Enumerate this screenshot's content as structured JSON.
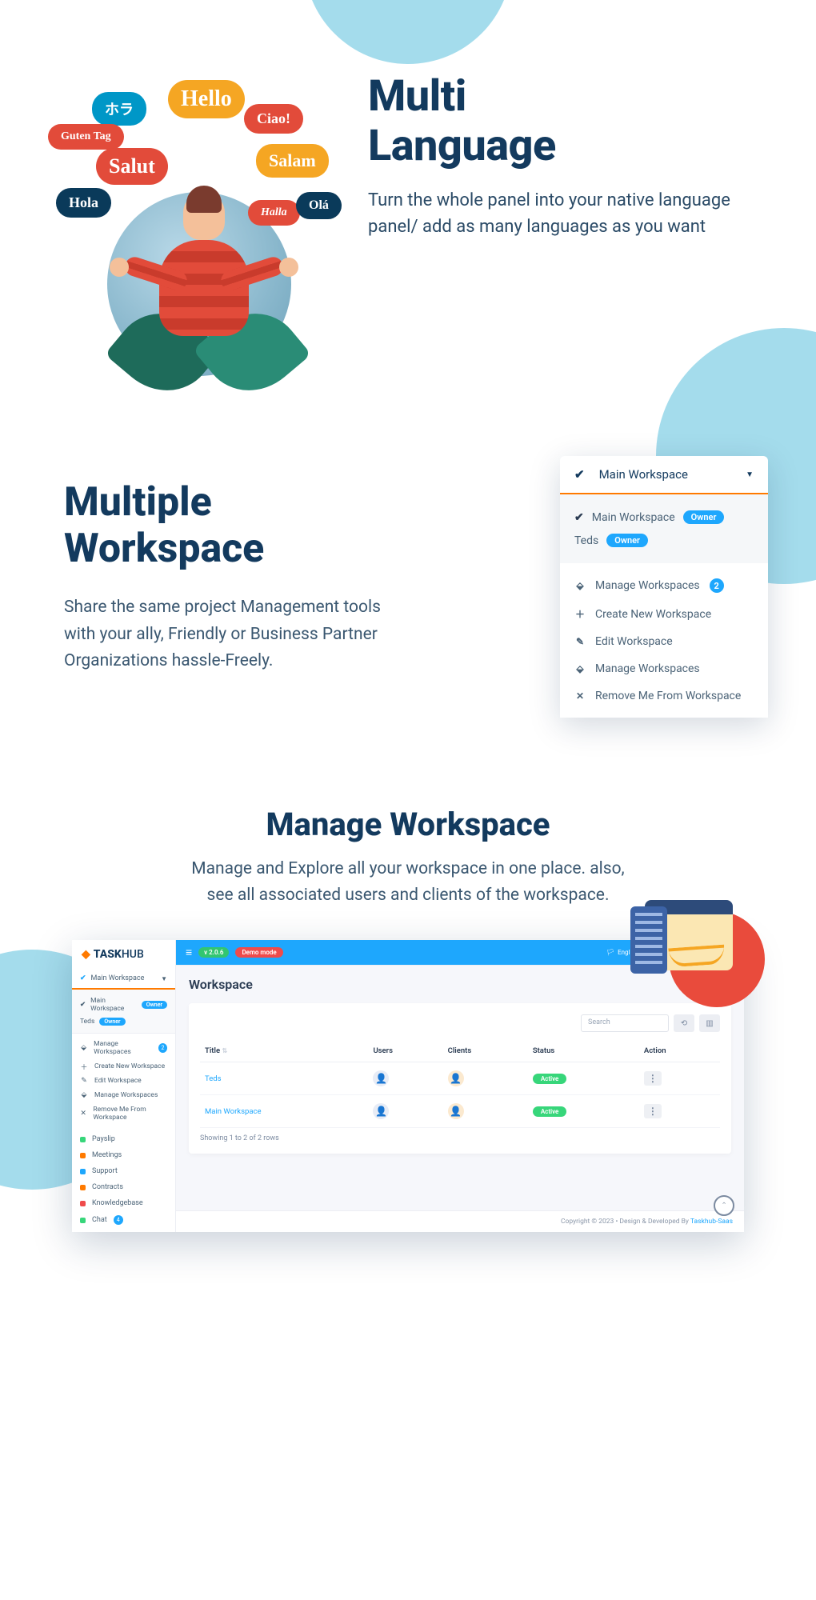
{
  "section1": {
    "title_l1": "Multi",
    "title_l2": "Language",
    "desc": "Turn the whole panel into your native language panel/ add as many languages as you want",
    "bubbles": {
      "hello": "Hello",
      "hora": "ホラ",
      "ciao": "Ciao!",
      "guten": "Guten Tag",
      "salut": "Salut",
      "salam": "Salam",
      "hola": "Hola",
      "halla": "Halla",
      "ola": "Olá"
    }
  },
  "section2": {
    "title_l1": "Multiple",
    "title_l2": "Workspace",
    "desc": "Share the same project Management tools with your ally, Friendly or Business Partner Organizations hassle-Freely.",
    "dropdown": {
      "header": "Main Workspace",
      "rows": [
        {
          "label": "Main Workspace",
          "badge": "Owner"
        },
        {
          "label": "Teds",
          "badge": "Owner"
        }
      ],
      "menu": [
        {
          "icon": "chart",
          "label": "Manage Workspaces",
          "count": "2"
        },
        {
          "icon": "plus",
          "label": "Create New Workspace"
        },
        {
          "icon": "edit",
          "label": "Edit Workspace"
        },
        {
          "icon": "chart",
          "label": "Manage Workspaces"
        },
        {
          "icon": "close",
          "label": "Remove Me From Workspace"
        }
      ]
    }
  },
  "section3": {
    "title": "Manage Workspace",
    "desc": "Manage and Explore all your workspace in one place. also, see all associated users and clients of the workspace.",
    "app": {
      "logo_prefix": "TASK",
      "logo_suffix": "HUB",
      "version": "v 2.0.6",
      "demo": "Demo mode",
      "lang": "English",
      "sidebar_dd": "Main Workspace",
      "sidebar_rows": [
        {
          "label": "Main Workspace",
          "badge": "Owner"
        },
        {
          "label": "Teds",
          "badge": "Owner"
        }
      ],
      "sidebar_menu": [
        {
          "icon": "chart",
          "label": "Manage Workspaces",
          "count": "2"
        },
        {
          "icon": "plus",
          "label": "Create New Workspace"
        },
        {
          "icon": "edit",
          "label": "Edit Workspace"
        },
        {
          "icon": "chart",
          "label": "Manage Workspaces"
        },
        {
          "icon": "close",
          "label": "Remove Me From Workspace"
        }
      ],
      "nav": [
        {
          "color": "#37d67a",
          "label": "Payslip"
        },
        {
          "color": "#ff7a00",
          "label": "Meetings"
        },
        {
          "color": "#1ea7fd",
          "label": "Support"
        },
        {
          "color": "#ff7a00",
          "label": "Contracts"
        },
        {
          "color": "#ef4b4b",
          "label": "Knowledgebase"
        },
        {
          "color": "#37d67a",
          "label": "Chat",
          "badge": "4"
        }
      ],
      "page_title": "Workspace",
      "search_placeholder": "Search",
      "columns": {
        "title": "Title",
        "users": "Users",
        "clients": "Clients",
        "status": "Status",
        "action": "Action"
      },
      "rows": [
        {
          "title": "Teds",
          "status": "Active"
        },
        {
          "title": "Main Workspace",
          "status": "Active"
        }
      ],
      "showing": "Showing 1 to 2 of 2 rows",
      "footer_copyright": "Copyright © 2023",
      "footer_dev": " • Design & Developed By ",
      "footer_link": "Taskhub-Saas"
    }
  }
}
